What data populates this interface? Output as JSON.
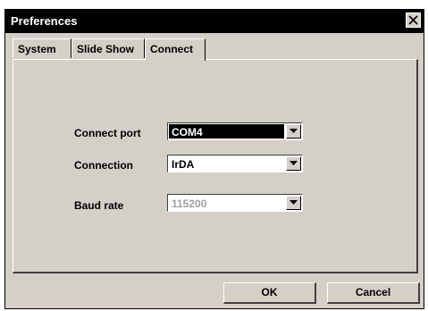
{
  "window": {
    "title": "Preferences",
    "close_icon": "close-icon"
  },
  "tabs": [
    {
      "label": "System"
    },
    {
      "label": "Slide Show"
    },
    {
      "label": "Connect",
      "active": true
    }
  ],
  "form": {
    "connect_port": {
      "label": "Connect port",
      "value": "COM4",
      "state": "selected"
    },
    "connection": {
      "label": "Connection",
      "value": "IrDA",
      "state": "normal"
    },
    "baud_rate": {
      "label": "Baud  rate",
      "value": "115200",
      "state": "disabled"
    }
  },
  "buttons": {
    "ok": "OK",
    "cancel": "Cancel"
  },
  "colors": {
    "titlebar": "#000000",
    "face": "#d4d0c8",
    "selection": "#000000",
    "disabled_text": "#a0a0a0"
  }
}
